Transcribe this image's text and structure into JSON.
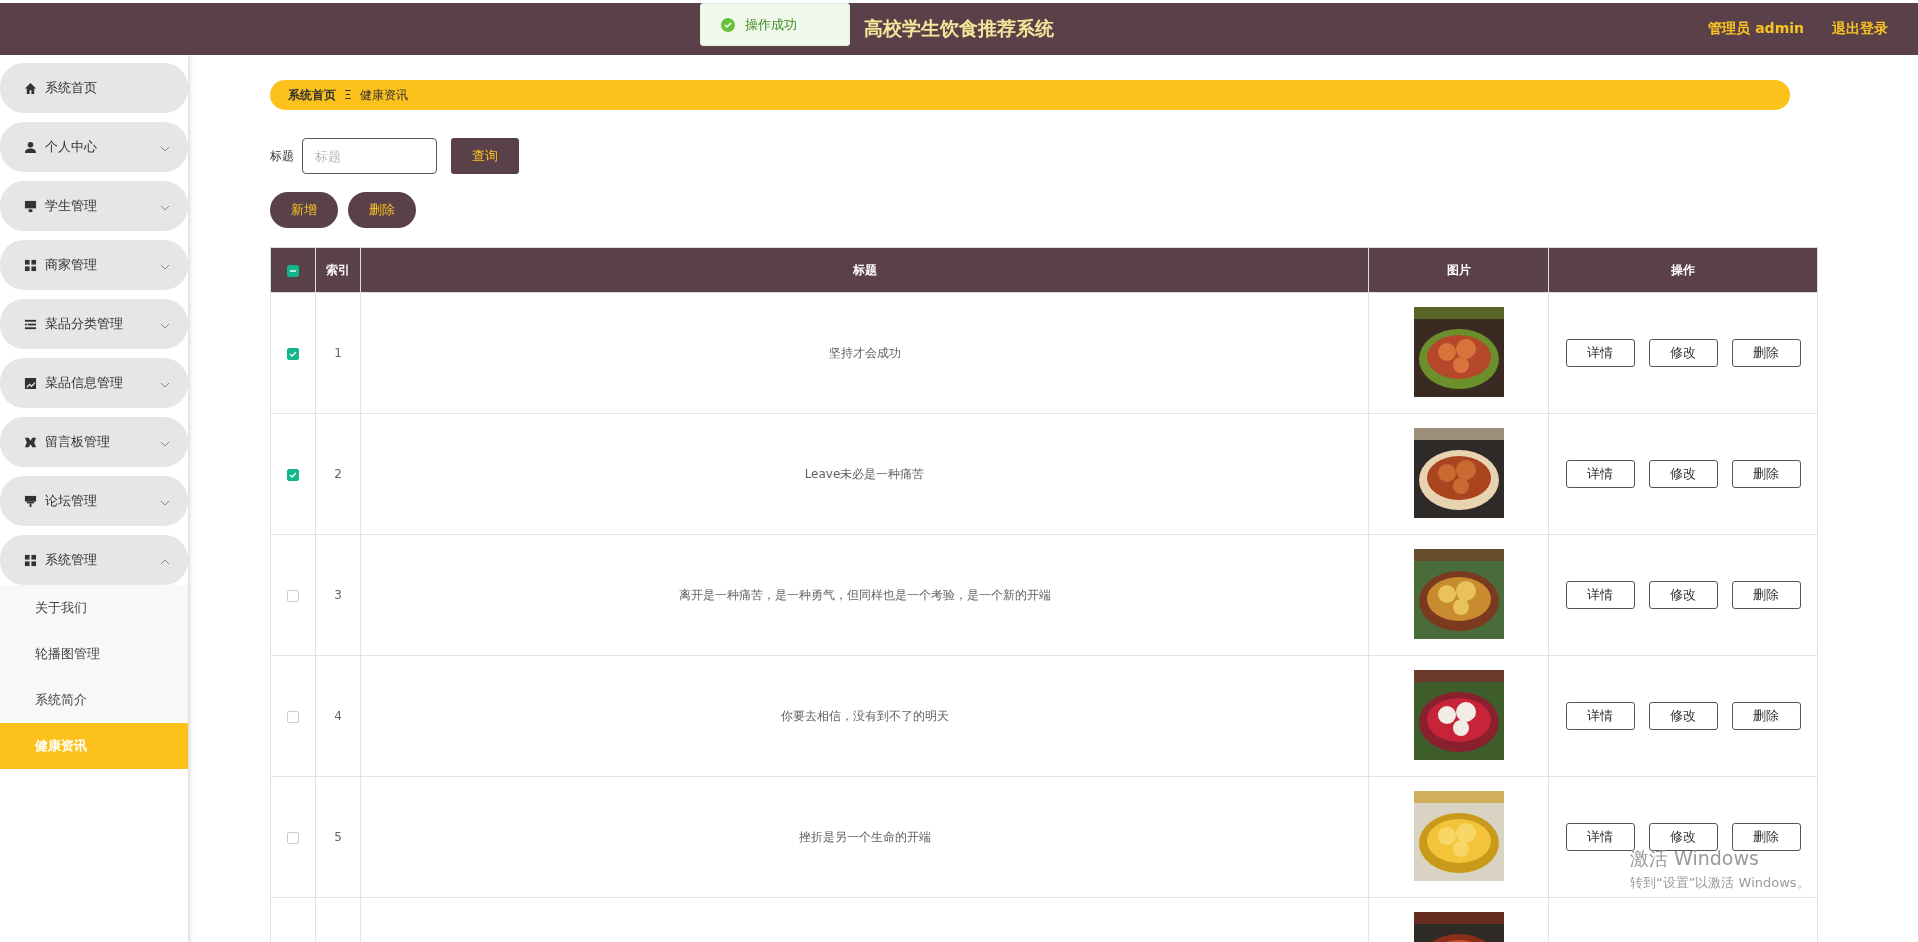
{
  "header": {
    "title": "高校学生饮食推荐系统",
    "user": "管理员 admin",
    "logout": "退出登录"
  },
  "toast": {
    "message": "操作成功"
  },
  "sidebar": {
    "items": [
      {
        "label": "系统首页"
      },
      {
        "label": "个人中心",
        "expanded": false
      },
      {
        "label": "学生管理",
        "expanded": false
      },
      {
        "label": "商家管理",
        "expanded": false
      },
      {
        "label": "菜品分类管理",
        "expanded": false
      },
      {
        "label": "菜品信息管理",
        "expanded": false
      },
      {
        "label": "留言板管理",
        "expanded": false
      },
      {
        "label": "论坛管理",
        "expanded": false
      },
      {
        "label": "系统管理",
        "expanded": true,
        "children": [
          {
            "label": "关于我们",
            "selected": false
          },
          {
            "label": "轮播图管理",
            "selected": false
          },
          {
            "label": "系统简介",
            "selected": false
          },
          {
            "label": "健康资讯",
            "selected": true
          }
        ]
      }
    ]
  },
  "breadcrumb": {
    "home": "系统首页",
    "separator": "Ξ",
    "current": "健康资讯"
  },
  "search": {
    "label": "标题",
    "placeholder": "标题",
    "button": "查询"
  },
  "actions": [
    "新增",
    "删除"
  ],
  "table": {
    "select_all": {
      "indeterminate": true
    },
    "columns": [
      "索引",
      "标题",
      "图片",
      "操作"
    ],
    "rows": [
      {
        "checked": true,
        "index": "1",
        "title": "坚持才会成功",
        "kind": "picture",
        "buttons": [
          "详情",
          "修改",
          "删除"
        ]
      },
      {
        "checked": true,
        "index": "2",
        "title": "Leave未必是一种痛苦",
        "kind": "picture",
        "buttons": [
          "详情",
          "修改",
          "删除"
        ]
      },
      {
        "checked": false,
        "index": "3",
        "title": "离开是一种痛苦，是一种勇气，但同样也是一个考验，是一个新的开端",
        "kind": "picture",
        "buttons": [
          "详情",
          "修改",
          "删除"
        ]
      },
      {
        "checked": false,
        "index": "4",
        "title": "你要去相信，没有到不了的明天",
        "kind": "picture",
        "buttons": [
          "详情",
          "修改",
          "删除"
        ]
      },
      {
        "checked": false,
        "index": "5",
        "title": "挫折是另一个生命的开端",
        "kind": "picture",
        "buttons": [
          "详情",
          "修改",
          "删除"
        ]
      },
      {
        "kind": "picture"
      }
    ]
  },
  "os_notice": {
    "title": "激活 Windows",
    "subtitle": "转到“设置”以激活 Windows。"
  }
}
